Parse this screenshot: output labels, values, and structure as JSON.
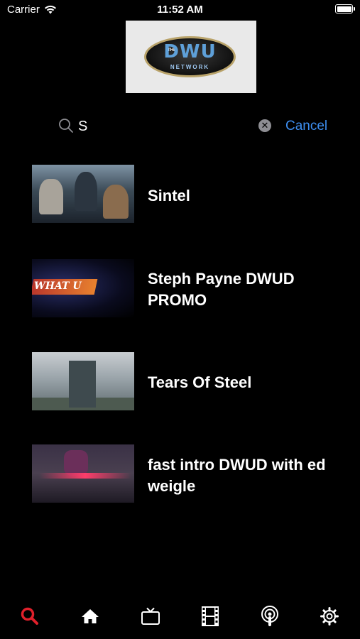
{
  "status_bar": {
    "carrier": "Carrier",
    "time": "11:52 AM"
  },
  "logo": {
    "the": "THE",
    "name": "DWU",
    "network": "NETWORK"
  },
  "search": {
    "query": "S",
    "cancel_label": "Cancel"
  },
  "results": [
    {
      "title": "Sintel"
    },
    {
      "title": "Steph Payne DWUD PROMO"
    },
    {
      "title": "Tears Of Steel"
    },
    {
      "title": "fast intro DWUD with ed weigle"
    }
  ],
  "tab_bar": {
    "items": [
      {
        "icon": "search-icon",
        "active": true
      },
      {
        "icon": "home-icon",
        "active": false
      },
      {
        "icon": "tv-icon",
        "active": false
      },
      {
        "icon": "film-icon",
        "active": false
      },
      {
        "icon": "podcast-icon",
        "active": false
      },
      {
        "icon": "gear-icon",
        "active": false
      }
    ]
  },
  "colors": {
    "background": "#000000",
    "accent_active_tab": "#e0202b",
    "link_blue": "#3d8ef0",
    "text": "#ffffff"
  }
}
